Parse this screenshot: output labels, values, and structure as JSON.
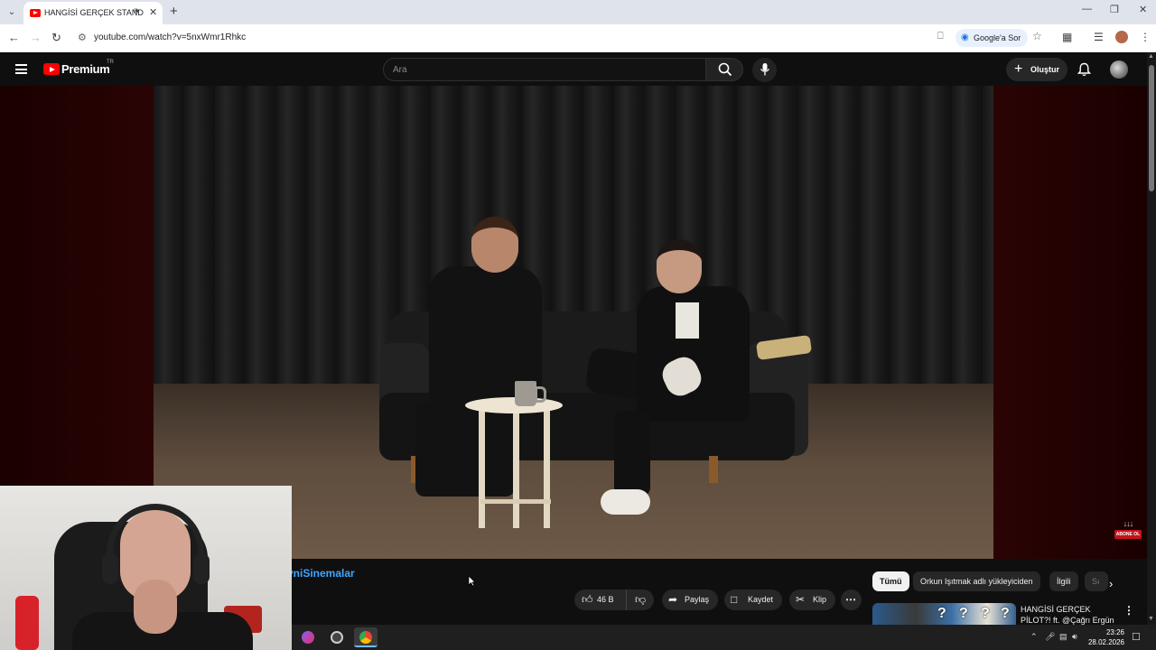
{
  "browser": {
    "tab_title": "HANGİSİ GERÇEK STAND-U",
    "tab_audio_icon": "speaker-icon",
    "url": "youtube.com/watch?v=5nxWmr1Rhkc",
    "google_sor_label": "Google'a Sor"
  },
  "youtube": {
    "brand": "Premium",
    "region": "TR",
    "search_placeholder": "Ara",
    "create_label": "Oluştur",
    "channel_name": "yniSinemalar",
    "like_count": "46 B",
    "share_label": "Paylaş",
    "save_label": "Kaydet",
    "clip_label": "Klip",
    "chips": [
      "Tümü",
      "Orkun Işıtmak adlı yükleyiciden",
      "İlgili",
      "Sı"
    ],
    "recommended": {
      "title": "HANGİSİ GERÇEK PİLOT?! ft. @Çağrı Ergün",
      "thumb_marks": [
        "?",
        "?",
        "?",
        "?"
      ]
    },
    "watermark": {
      "arrows": "↓↓↓",
      "text": "ABONE OL"
    }
  },
  "taskbar": {
    "time": "23:26",
    "date": "28.02.2026"
  },
  "colors": {
    "youtube_red": "#ff0000",
    "link_blue": "#3ea6ff",
    "chip_active_bg": "#f1f1f1"
  }
}
